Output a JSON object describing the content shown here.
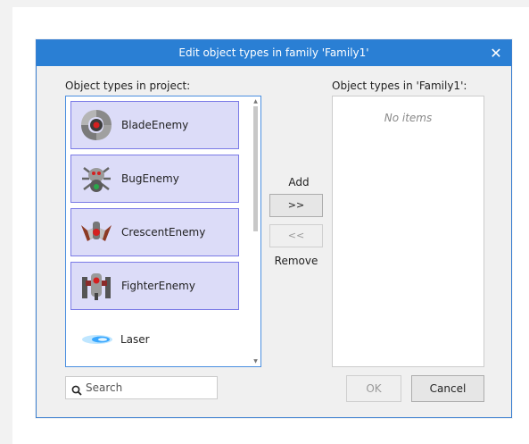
{
  "dialog": {
    "title": "Edit object types in family 'Family1'",
    "close_icon": "close-icon"
  },
  "left_panel": {
    "label": "Object types in project:",
    "items": [
      {
        "name": "BladeEnemy",
        "icon": "blade-enemy-icon",
        "selected": true
      },
      {
        "name": "BugEnemy",
        "icon": "bug-enemy-icon",
        "selected": true
      },
      {
        "name": "CrescentEnemy",
        "icon": "crescent-enemy-icon",
        "selected": true
      },
      {
        "name": "FighterEnemy",
        "icon": "fighter-enemy-icon",
        "selected": true
      },
      {
        "name": "Laser",
        "icon": "laser-icon",
        "selected": false
      }
    ]
  },
  "right_panel": {
    "label": "Object types in 'Family1':",
    "empty_text": "No items"
  },
  "transfer": {
    "add_label": "Add",
    "add_button": ">>",
    "remove_button": "<<",
    "remove_label": "Remove"
  },
  "search": {
    "placeholder": "Search",
    "value": ""
  },
  "footer": {
    "ok_label": "OK",
    "cancel_label": "Cancel"
  },
  "colors": {
    "titlebar": "#2a7fd4",
    "selection": "#dcdcf8",
    "selection_border": "#7a7ae6"
  }
}
